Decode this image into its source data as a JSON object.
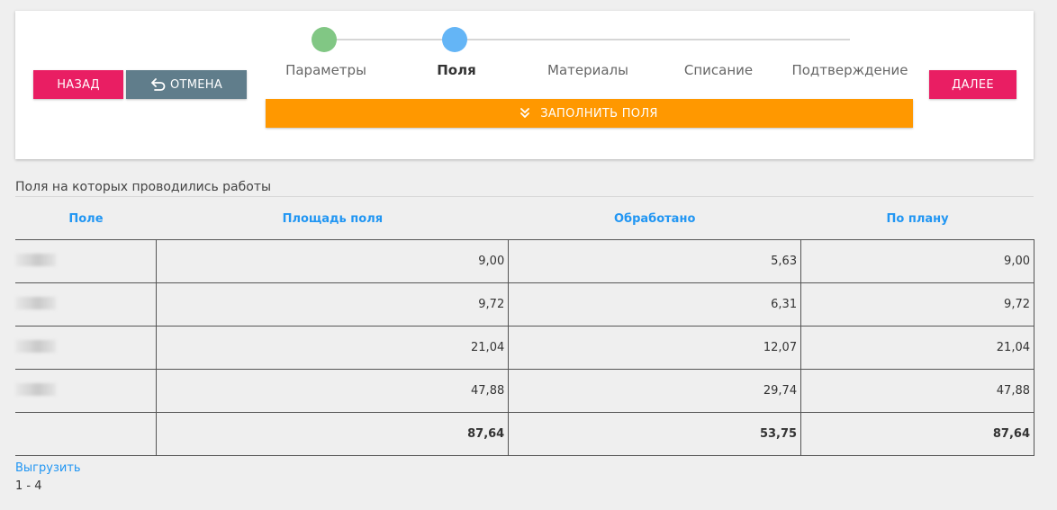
{
  "wizard": {
    "back_label": "НАЗАД",
    "cancel_label": "ОТМЕНА",
    "next_label": "ДАЛЕЕ",
    "fill_label": "ЗАПОЛНИТЬ ПОЛЯ",
    "steps": [
      {
        "label": "Параметры",
        "state": "done"
      },
      {
        "label": "Поля",
        "state": "current"
      },
      {
        "label": "Материалы",
        "state": "pending"
      },
      {
        "label": "Списание",
        "state": "pending"
      },
      {
        "label": "Подтверждение",
        "state": "pending"
      }
    ],
    "colors": {
      "back": "#e91e63",
      "cancel": "#607d8b",
      "fill": "#ff9800",
      "step_done": "#81c784",
      "step_current": "#64b5f6"
    }
  },
  "section": {
    "title": "Поля на которых проводились работы"
  },
  "table": {
    "headers": [
      "Поле",
      "Площадь поля",
      "Обработано",
      "По плану"
    ],
    "rows": [
      {
        "area": "9,00",
        "processed": "5,63",
        "plan": "9,00"
      },
      {
        "area": "9,72",
        "processed": "6,31",
        "plan": "9,72"
      },
      {
        "area": "21,04",
        "processed": "12,07",
        "plan": "21,04"
      },
      {
        "area": "47,88",
        "processed": "29,74",
        "plan": "47,88"
      }
    ],
    "total": {
      "area": "87,64",
      "processed": "53,75",
      "plan": "87,64"
    }
  },
  "footer": {
    "export_label": "Выгрузить",
    "pager_text": "1 - 4"
  }
}
